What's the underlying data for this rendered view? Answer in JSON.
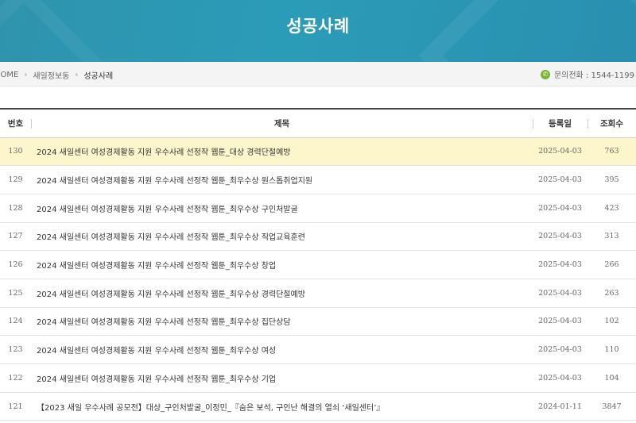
{
  "banner": {
    "title": "성공사례"
  },
  "breadcrumb": {
    "home": "HOME",
    "separator": "›",
    "level1": "새일정보동",
    "current": "성공사례"
  },
  "contact": {
    "label": "문의전화 : 1544-1199",
    "icon": "phone-icon",
    "icon_color": "#7cb334"
  },
  "table": {
    "headers": {
      "num": "번호",
      "title": "제목",
      "date": "등록일",
      "views": "조회수"
    },
    "rows": [
      {
        "num": "130",
        "title": "2024 새일센터 여성경제활동 지원 우수사례 선정작 웹툰_대상 경력단절예방",
        "date": "2025-04-03",
        "views": "763"
      },
      {
        "num": "129",
        "title": "2024 새일센터 여성경제활동 지원 우수사례 선정작 웹툰_최우수상 원스톱취업지원",
        "date": "2025-04-03",
        "views": "395"
      },
      {
        "num": "128",
        "title": "2024 새일센터 여성경제활동 지원 우수사례 선정작 웹툰_최우수상 구인처발굴",
        "date": "2025-04-03",
        "views": "423"
      },
      {
        "num": "127",
        "title": "2024 새일센터 여성경제활동 지원 우수사례 선정작 웹툰_최우수상 직업교육훈련",
        "date": "2025-04-03",
        "views": "313"
      },
      {
        "num": "126",
        "title": "2024 새일센터 여성경제활동 지원 우수사례 선정작 웹툰_최우수상 창업",
        "date": "2025-04-03",
        "views": "266"
      },
      {
        "num": "125",
        "title": "2024 새일센터 여성경제활동 지원 우수사례 선정작 웹툰_최우수상 경력단절예방",
        "date": "2025-04-03",
        "views": "263"
      },
      {
        "num": "124",
        "title": "2024 새일센터 여성경제활동 지원 우수사례 선정작 웹툰_최우수상 집단상담",
        "date": "2025-04-03",
        "views": "102"
      },
      {
        "num": "123",
        "title": "2024 새일센터 여성경제활동 지원 우수사례 선정작 웹툰_최우수상 여성",
        "date": "2025-04-03",
        "views": "110"
      },
      {
        "num": "122",
        "title": "2024 새일센터 여성경제활동 지원 우수사례 선정작 웹툰_최우수상 기업",
        "date": "2025-04-03",
        "views": "104"
      },
      {
        "num": "121",
        "title": "【2023 새일 우수사례 공모전】대상_구인처발굴_이정민_『숨은 보석, 구인난 해결의 열쇠 ‘새일센터’』",
        "date": "2024-01-11",
        "views": "3847"
      }
    ],
    "highlight_color": "#fdf6cc"
  },
  "colors": {
    "banner": "#2b9cb8"
  }
}
